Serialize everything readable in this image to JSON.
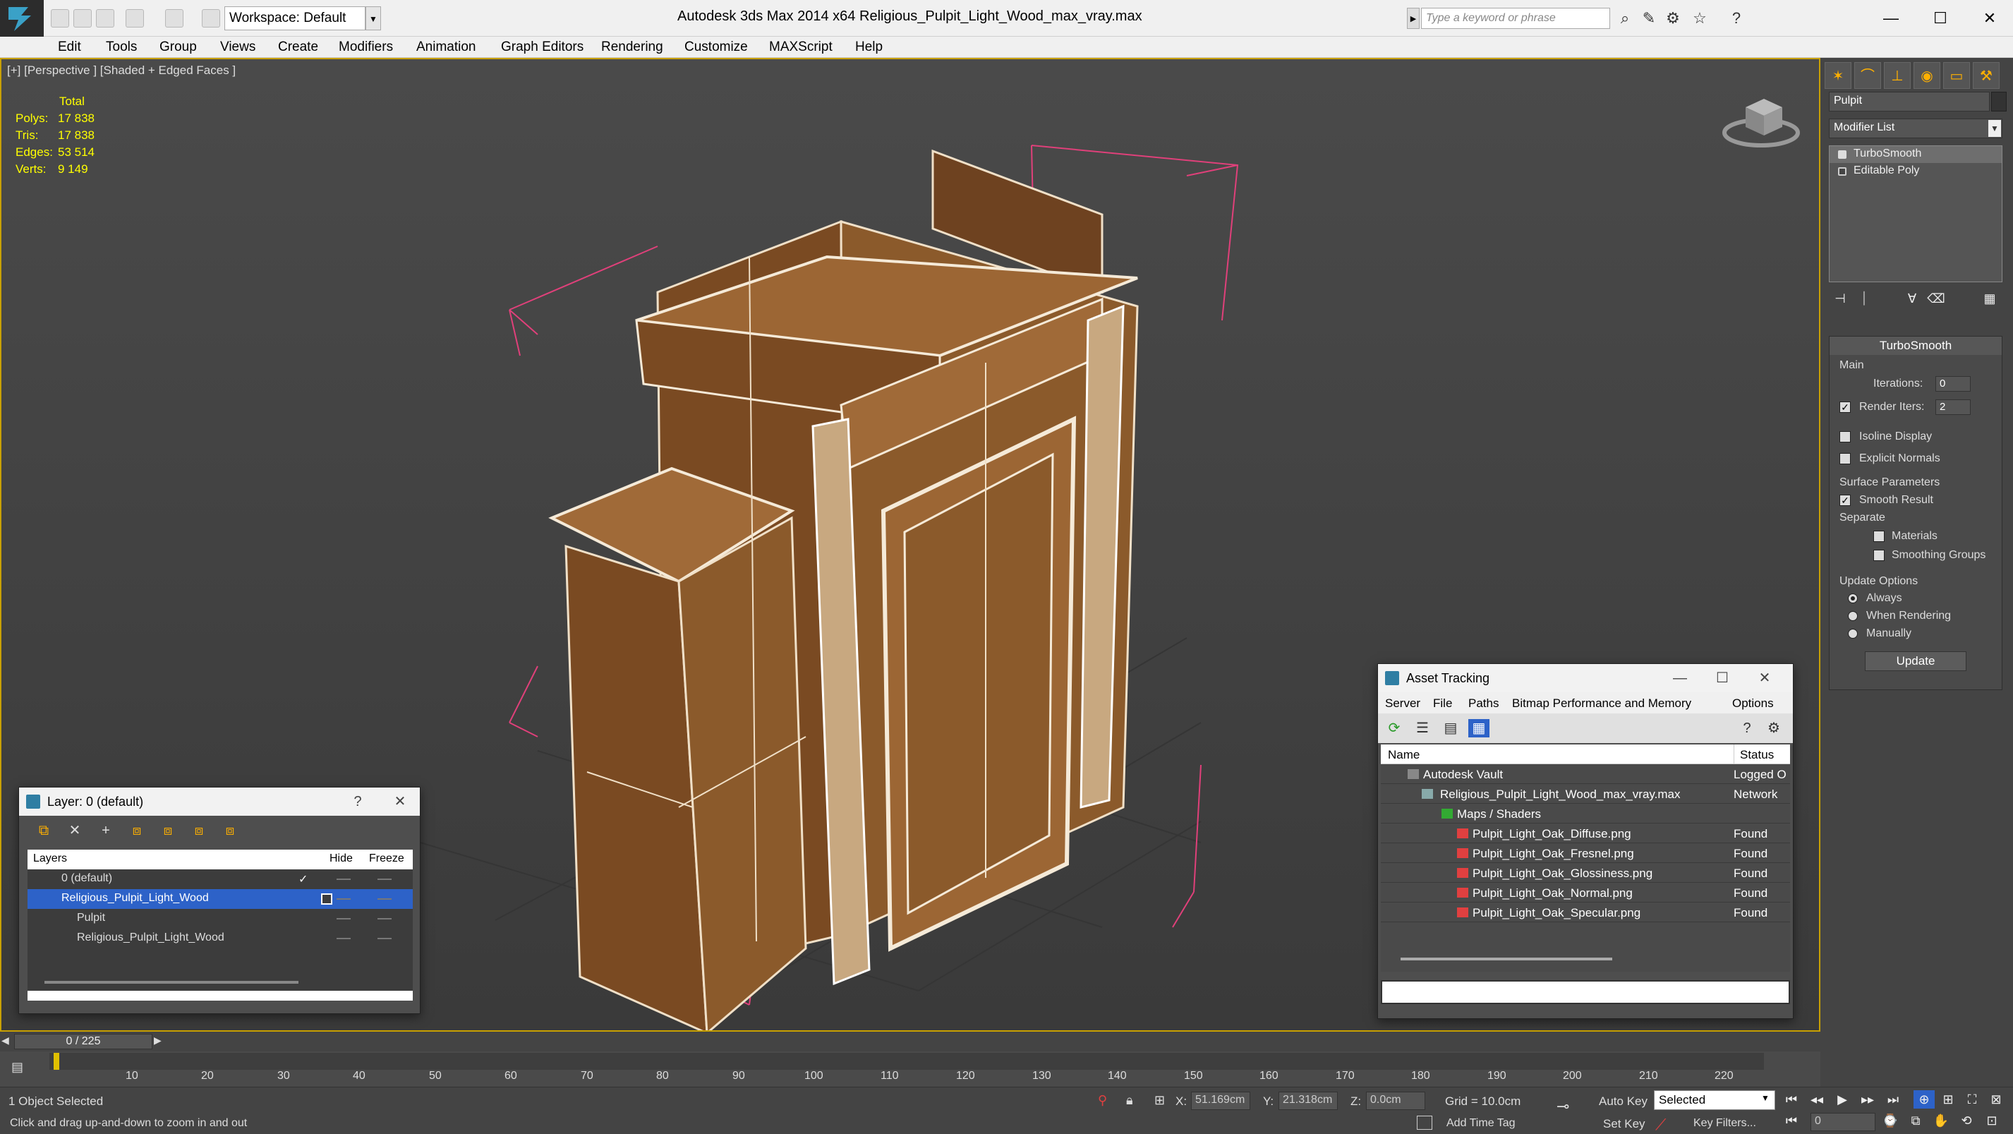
{
  "titlebar": {
    "workspace": "Workspace: Default",
    "app_title": "Autodesk 3ds Max  2014 x64",
    "file_title": "Religious_Pulpit_Light_Wood_max_vray.max",
    "search_placeholder": "Type a keyword or phrase"
  },
  "menu": [
    "Edit",
    "Tools",
    "Group",
    "Views",
    "Create",
    "Modifiers",
    "Animation",
    "Graph Editors",
    "Rendering",
    "Customize",
    "MAXScript",
    "Help"
  ],
  "viewport": {
    "label": "[+] [Perspective ] [Shaded + Edged Faces ]",
    "stats": {
      "header": "Total",
      "rows": [
        {
          "label": "Polys:",
          "value": "17 838"
        },
        {
          "label": "Tris:",
          "value": "17 838"
        },
        {
          "label": "Edges:",
          "value": "53 514"
        },
        {
          "label": "Verts:",
          "value": "9 149"
        }
      ]
    }
  },
  "command_panel": {
    "object_name": "Pulpit",
    "modifier_list": "Modifier List",
    "stack": [
      "TurboSmooth",
      "Editable Poly"
    ],
    "rollout": {
      "title": "TurboSmooth",
      "main_label": "Main",
      "iterations_label": "Iterations:",
      "iterations_value": "0",
      "render_iters_label": "Render Iters:",
      "render_iters_value": "2",
      "isoline_label": "Isoline Display",
      "explicit_label": "Explicit Normals",
      "surface_label": "Surface Parameters",
      "smooth_label": "Smooth Result",
      "separate_label": "Separate",
      "materials_label": "Materials",
      "smoothing_groups_label": "Smoothing Groups",
      "update_options_label": "Update Options",
      "always_label": "Always",
      "when_rendering_label": "When Rendering",
      "manually_label": "Manually",
      "update_button": "Update"
    }
  },
  "layer_window": {
    "title": "Layer: 0 (default)",
    "help": "?",
    "headers": {
      "layers": "Layers",
      "hide": "Hide",
      "freeze": "Freeze"
    },
    "rows": [
      "0 (default)",
      "Religious_Pulpit_Light_Wood",
      "Pulpit",
      "Religious_Pulpit_Light_Wood"
    ]
  },
  "asset_window": {
    "title": "Asset Tracking",
    "menu": [
      "Server",
      "File",
      "Paths",
      "Bitmap Performance and Memory",
      "Options"
    ],
    "headers": {
      "name": "Name",
      "status": "Status"
    },
    "rows": [
      {
        "name": "Autodesk Vault",
        "status": "Logged O"
      },
      {
        "name": "Religious_Pulpit_Light_Wood_max_vray.max",
        "status": "Network"
      },
      {
        "name": "Maps / Shaders",
        "status": ""
      },
      {
        "name": "Pulpit_Light_Oak_Diffuse.png",
        "status": "Found"
      },
      {
        "name": "Pulpit_Light_Oak_Fresnel.png",
        "status": "Found"
      },
      {
        "name": "Pulpit_Light_Oak_Glossiness.png",
        "status": "Found"
      },
      {
        "name": "Pulpit_Light_Oak_Normal.png",
        "status": "Found"
      },
      {
        "name": "Pulpit_Light_Oak_Specular.png",
        "status": "Found"
      }
    ]
  },
  "timeline": {
    "frame": "0 / 225",
    "ticks": [
      "10",
      "20",
      "30",
      "40",
      "50",
      "60",
      "70",
      "80",
      "90",
      "100",
      "110",
      "120",
      "130",
      "140",
      "150",
      "160",
      "170",
      "180",
      "190",
      "200",
      "210",
      "220"
    ]
  },
  "status": {
    "selected": "1 Object Selected",
    "prompt": "Click and drag up-and-down to zoom in and out",
    "x_label": "X:",
    "x_value": "51.169cm",
    "y_label": "Y:",
    "y_value": "21.318cm",
    "z_label": "Z:",
    "z_value": "0.0cm",
    "grid": "Grid = 10.0cm",
    "add_time_tag": "Add Time Tag",
    "auto_key": "Auto Key",
    "set_key": "Set Key",
    "selected_dropdown": "Selected",
    "key_filters": "Key Filters...",
    "frame_field": "0"
  },
  "colors": {
    "accent": "#c8a000",
    "selection": "#2d62c8",
    "wood": "#8b5a2b"
  }
}
